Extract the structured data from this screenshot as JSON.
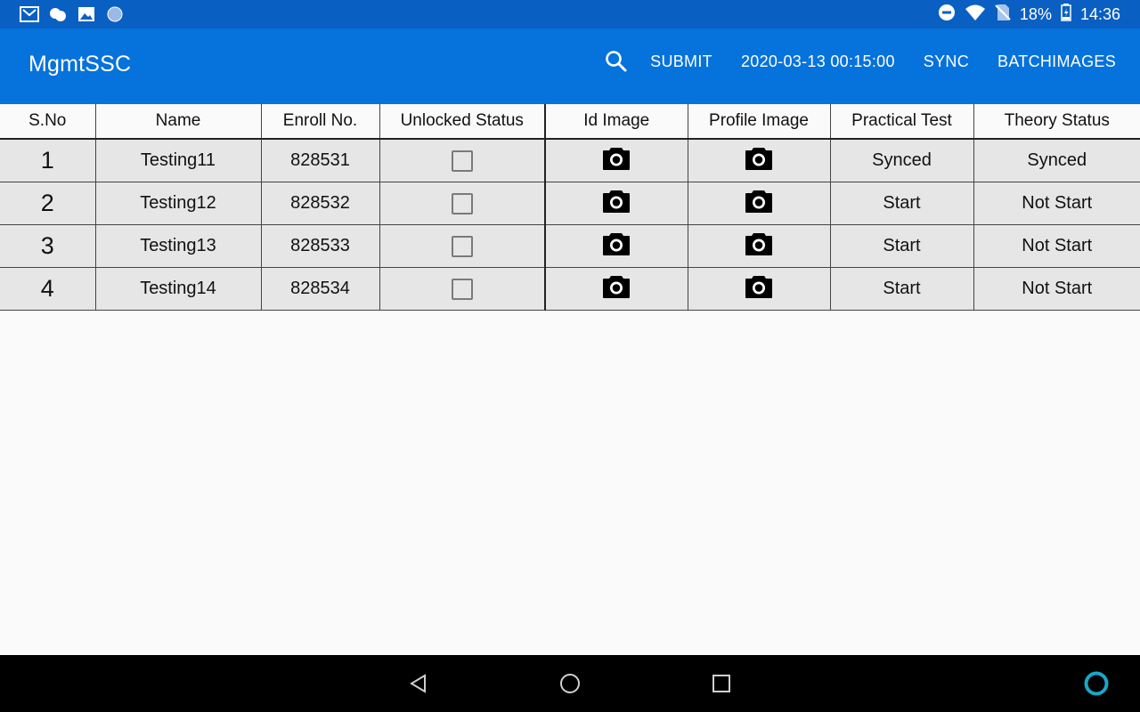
{
  "status_bar": {
    "left_icons": [
      "mail-icon",
      "weather-icon",
      "image-icon",
      "circle-icon"
    ],
    "battery_percent": "18%",
    "time": "14:36"
  },
  "app_bar": {
    "title": "MgmtSSC",
    "submit_label": "SUBMIT",
    "datetime": "2020-03-13 00:15:00",
    "sync_label": "SYNC",
    "batchimages_label": "BATCHIMAGES"
  },
  "table": {
    "headers": [
      "S.No",
      "Name",
      "Enroll No.",
      "Unlocked Status",
      "Id Image",
      "Profile Image",
      "Practical Test",
      "Theory Status"
    ],
    "rows": [
      {
        "sno": "1",
        "name": "Testing11",
        "enroll": "828531",
        "unlocked": false,
        "practical": "Synced",
        "theory": "Synced"
      },
      {
        "sno": "2",
        "name": "Testing12",
        "enroll": "828532",
        "unlocked": false,
        "practical": "Start",
        "theory": "Not Start"
      },
      {
        "sno": "3",
        "name": "Testing13",
        "enroll": "828533",
        "unlocked": false,
        "practical": "Start",
        "theory": "Not Start"
      },
      {
        "sno": "4",
        "name": "Testing14",
        "enroll": "828534",
        "unlocked": false,
        "practical": "Start",
        "theory": "Not Start"
      }
    ]
  },
  "colors": {
    "status_bar": "#0a5fc2",
    "app_bar": "#0672dc",
    "row_bg": "#e6e6e6",
    "assistant_ring": "#1aa6c8"
  }
}
